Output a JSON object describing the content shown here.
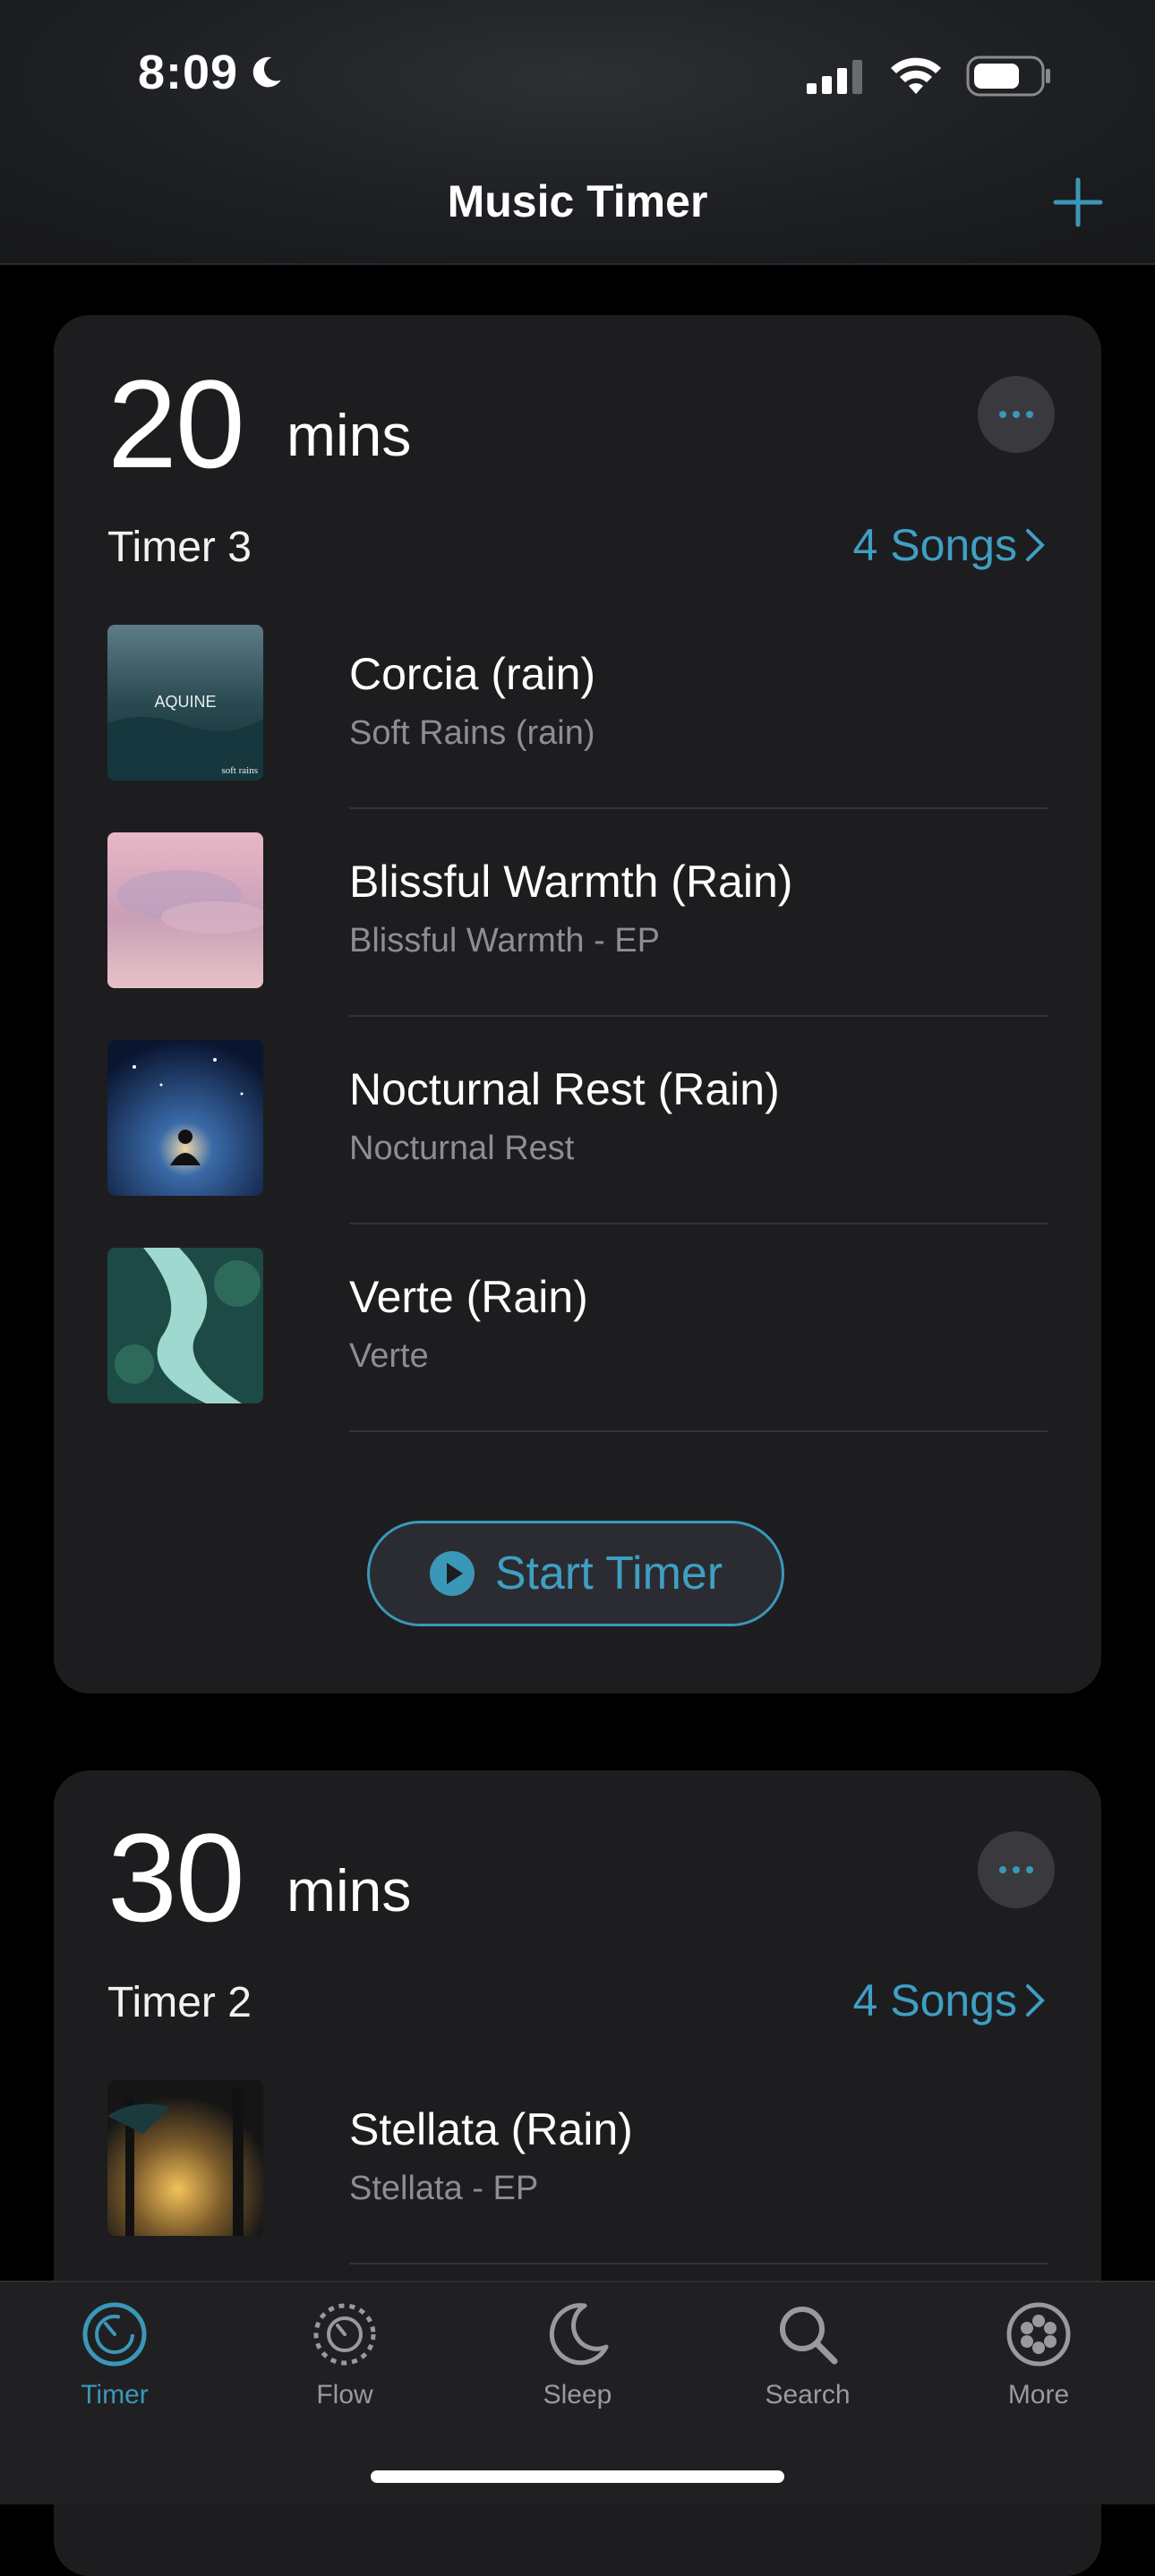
{
  "status_bar": {
    "time": "8:09"
  },
  "nav": {
    "title": "Music Timer",
    "add_icon": "plus-icon"
  },
  "timers": [
    {
      "duration_value": "20",
      "duration_unit": "mins",
      "name": "Timer 3",
      "songs_link": "4 Songs",
      "songs": [
        {
          "title": "Corcia (rain)",
          "album": "Soft Rains (rain)"
        },
        {
          "title": "Blissful Warmth (Rain)",
          "album": "Blissful Warmth - EP"
        },
        {
          "title": "Nocturnal Rest (Rain)",
          "album": "Nocturnal Rest"
        },
        {
          "title": "Verte (Rain)",
          "album": "Verte"
        }
      ],
      "start_label": "Start Timer",
      "art_text": {
        "brand": "AQUINE",
        "caption": "soft rains"
      }
    },
    {
      "duration_value": "30",
      "duration_unit": "mins",
      "name": "Timer 2",
      "songs_link": "4 Songs",
      "songs": [
        {
          "title": "Stellata (Rain)",
          "album": "Stellata - EP"
        }
      ]
    }
  ],
  "tabbar": {
    "items": [
      {
        "label": "Timer",
        "icon": "timer-icon",
        "active": true
      },
      {
        "label": "Flow",
        "icon": "flow-icon",
        "active": false
      },
      {
        "label": "Sleep",
        "icon": "moon-icon",
        "active": false
      },
      {
        "label": "Search",
        "icon": "search-icon",
        "active": false
      },
      {
        "label": "More",
        "icon": "more-icon",
        "active": false
      }
    ]
  },
  "colors": {
    "accent": "#3b97b8",
    "card": "#1d1d20",
    "background": "#000000"
  }
}
